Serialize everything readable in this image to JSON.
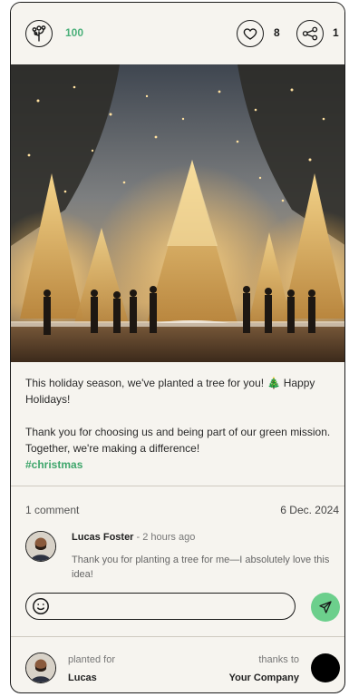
{
  "header": {
    "trees_planted": "100",
    "likes": "8",
    "shares": "1"
  },
  "post": {
    "line1": "This holiday season, we've planted a tree for you! 🎄 Happy Holidays!",
    "line2": "Thank you for choosing us and being part of our green mission. Together, we're making a difference!",
    "hashtag": "#christmas"
  },
  "comments": {
    "count_label": "1 comment",
    "date": "6 Dec. 2024",
    "items": [
      {
        "author": "Lucas Foster",
        "time": " - 2 hours ago",
        "text": "Thank you for planting a tree for me—I absolutely love this idea!"
      }
    ]
  },
  "composer": {
    "placeholder": ""
  },
  "footer": {
    "planted_for_label": "planted for",
    "planted_for_name": "Lucas",
    "thanks_to_label": "thanks to",
    "company": "Your Company"
  },
  "colors": {
    "accent": "#4bb07a",
    "send_button": "#6ccf8c",
    "card_background": "#f6f4ef"
  },
  "icons": [
    "tree-icon",
    "heart-icon",
    "share-icon",
    "emoji-icon",
    "send-icon"
  ]
}
